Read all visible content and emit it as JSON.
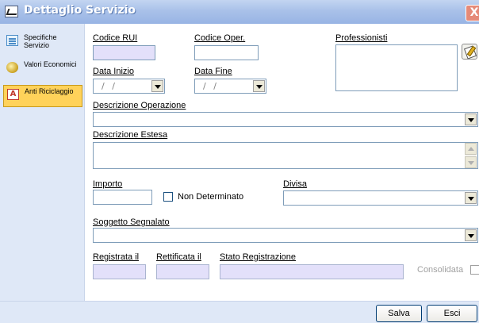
{
  "window": {
    "title": "Dettaglio Servizio",
    "close_label": "X"
  },
  "sidebar": {
    "items": [
      {
        "label": "Specifiche Servizio",
        "icon": "list-icon"
      },
      {
        "label": "Valori Economici",
        "icon": "coins-icon"
      },
      {
        "label": "Anti Riciclaggio",
        "icon": "anti-icon",
        "icon_text": "A"
      }
    ]
  },
  "form": {
    "codice_rui": {
      "label": "Codice RUI",
      "value": ""
    },
    "codice_oper": {
      "label": "Codice Oper.",
      "value": ""
    },
    "professionisti": {
      "label": "Professionisti",
      "value": ""
    },
    "data_inizio": {
      "label": "Data Inizio",
      "placeholder": "/ /"
    },
    "data_fine": {
      "label": "Data Fine",
      "placeholder": "/ /"
    },
    "descrizione_operazione": {
      "label": "Descrizione Operazione",
      "value": ""
    },
    "descrizione_estesa": {
      "label": "Descrizione Estesa",
      "value": ""
    },
    "importo": {
      "label": "Importo",
      "value": ""
    },
    "non_determinato": {
      "label": "Non Determinato",
      "checked": false
    },
    "divisa": {
      "label": "Divisa",
      "value": ""
    },
    "soggetto_segnalato": {
      "label": "Soggetto Segnalato",
      "value": ""
    },
    "registrata_il": {
      "label": "Registrata il",
      "value": ""
    },
    "rettificata_il": {
      "label": "Rettificata il",
      "value": ""
    },
    "stato_registrazione": {
      "label": "Stato Registrazione",
      "value": ""
    },
    "consolidata": {
      "label": "Consolidata",
      "checked": false
    }
  },
  "footer": {
    "save_label": "Salva",
    "exit_label": "Esci"
  },
  "colors": {
    "title_bar": "#a9c1e9",
    "sidebar_bg": "#dfe8f7",
    "readonly_field": "#e3e0fa",
    "active_item": "#ffd25a"
  }
}
